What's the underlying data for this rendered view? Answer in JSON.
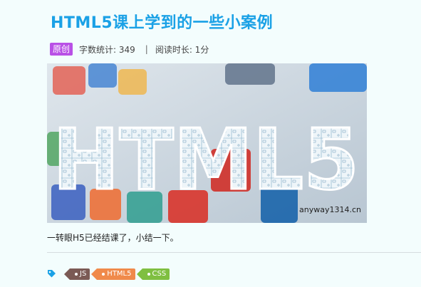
{
  "post": {
    "title": "HTML5课上学到的一些小案例",
    "badge": "原创",
    "word_count": "字数统计: 349",
    "separator": "|",
    "read_time": "阅读时长: 1分",
    "cover": {
      "text": "HTML5",
      "watermark": "anyway1314.cn"
    },
    "summary": "一转眼H5已经结课了，小结一下。"
  },
  "tags": [
    {
      "label": "JS",
      "color": "#7b5a55"
    },
    {
      "label": "HTML5",
      "color": "#f08a4b"
    },
    {
      "label": "CSS",
      "color": "#7fbf41"
    }
  ],
  "colors": {
    "title": "#1aa1e6",
    "badge": "#b950e6",
    "background": "#f3fdfd"
  },
  "icons": {
    "tag": "tag-icon"
  }
}
